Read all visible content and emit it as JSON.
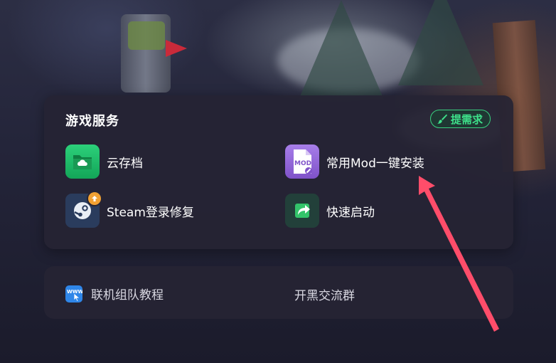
{
  "services_panel": {
    "title": "游戏服务",
    "demand_button": "提需求",
    "items": [
      {
        "label": "云存档",
        "icon": "cloud-folder-icon"
      },
      {
        "label": "常用Mod一键安装",
        "icon": "mod-file-icon"
      },
      {
        "label": "Steam登录修复",
        "icon": "steam-icon"
      },
      {
        "label": "快速启动",
        "icon": "launch-arrow-icon"
      }
    ]
  },
  "links_panel": {
    "tutorial": "联机组队教程",
    "tutorial_icon_text": "WWW",
    "group": "开黑交流群"
  },
  "colors": {
    "accent_green": "#3ee08a",
    "panel_bg": "#262434",
    "annotation_arrow": "#ff4d6a"
  }
}
